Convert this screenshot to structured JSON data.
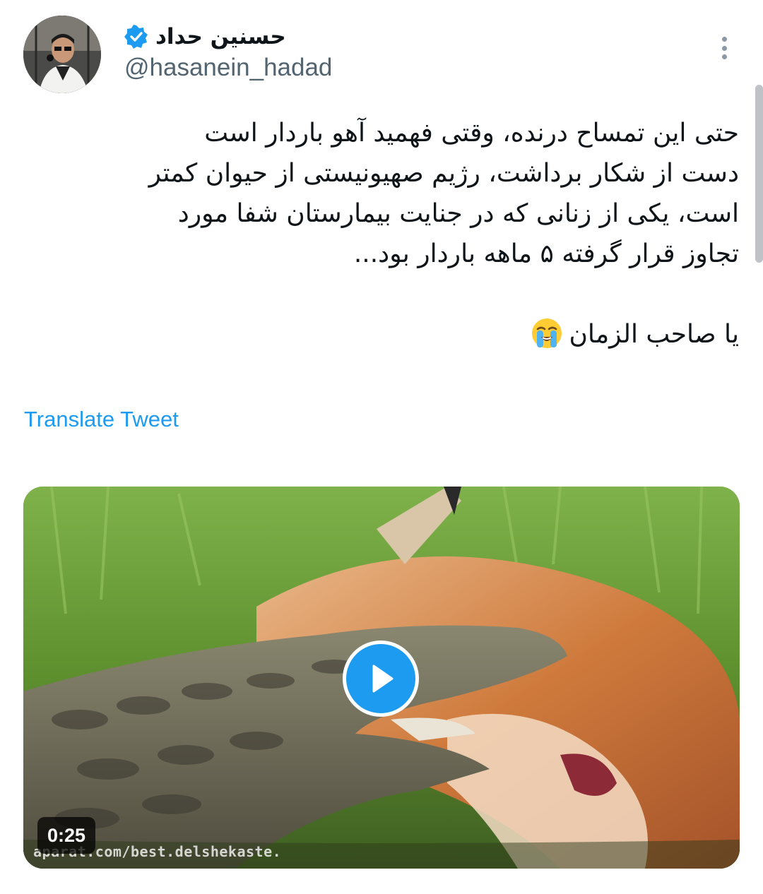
{
  "author": {
    "display_name": "حسنین حداد",
    "handle": "@hasanein_hadad",
    "verified": true
  },
  "tweet": {
    "lines": [
      "حتی این تمساح درنده، وقتی فهمید آهو باردار است",
      "دست از شکار برداشت، رژیم صهیونیستی از حیوان کمتر",
      "است، یکی از زنانی که  در جنایت بیمارستان شفا مورد",
      "تجاوز قرار گرفته ۵ ماهه باردار بود..."
    ],
    "closing_line": "یا صاحب الزمان",
    "closing_emoji": "loudly-crying-face-icon"
  },
  "translate_label": "Translate Tweet",
  "media": {
    "duration": "0:25",
    "watermark": "aparat.com/best.delshekaste."
  },
  "colors": {
    "accent": "#1d9bf0",
    "text": "#0f1419",
    "secondary": "#536471"
  },
  "icons": {
    "verified": "verified-badge-icon",
    "more": "more-vertical-icon",
    "play": "play-icon"
  }
}
